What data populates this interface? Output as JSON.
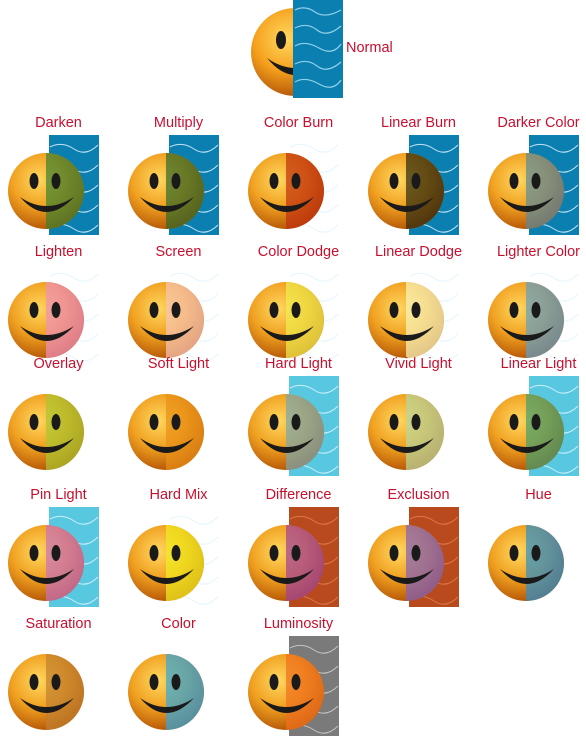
{
  "normal": {
    "label": "Normal"
  },
  "modes": [
    {
      "label": "Darken",
      "icon": "smiley-darken-blend",
      "face": "#f0a020",
      "overlay": "#0a7fb0",
      "tint": "#3a8030",
      "strip": "blue"
    },
    {
      "label": "Multiply",
      "icon": "smiley-multiply-blend",
      "face": "#f0a020",
      "overlay": "#0a7fb0",
      "tint": "#2f6a2a",
      "strip": "blue"
    },
    {
      "label": "Color Burn",
      "icon": "smiley-color-burn-blend",
      "face": "#f0a020",
      "overlay": "#ffffff",
      "tint": "#c03010",
      "strip": "white"
    },
    {
      "label": "Linear Burn",
      "icon": "smiley-linear-burn-blend",
      "face": "#f0a020",
      "overlay": "#0a7fb0",
      "tint": "#2a2a10",
      "strip": "blue"
    },
    {
      "label": "Darker Color",
      "icon": "smiley-darker-color-blend",
      "face": "#f0a020",
      "overlay": "#0a7fb0",
      "tint": "#5a8aa0",
      "strip": "blue"
    },
    {
      "label": "Lighten",
      "icon": "smiley-lighten-blend",
      "face": "#f0a020",
      "overlay": "#ffffff",
      "tint": "#f090c0",
      "strip": "white"
    },
    {
      "label": "Screen",
      "icon": "smiley-screen-blend",
      "face": "#f0a020",
      "overlay": "#ffffff",
      "tint": "#f8c8b8",
      "strip": "white"
    },
    {
      "label": "Color Dodge",
      "icon": "smiley-color-dodge-blend",
      "face": "#f0a020",
      "overlay": "#ffffff",
      "tint": "#f0f050",
      "strip": "white"
    },
    {
      "label": "Linear Dodge",
      "icon": "smiley-linear-dodge-blend",
      "face": "#f0a020",
      "overlay": "#ffffff",
      "tint": "#f8f8c0",
      "strip": "white"
    },
    {
      "label": "Lighter Color",
      "icon": "smiley-lighter-color-blend",
      "face": "#f0a020",
      "overlay": "#ffffff",
      "tint": "#60a0c8",
      "strip": "white"
    },
    {
      "label": "Overlay",
      "icon": "smiley-overlay-blend",
      "face": "#f0a020",
      "overlay": "#ffffff",
      "tint": "#a8c830",
      "strip": "none"
    },
    {
      "label": "Soft Light",
      "icon": "smiley-soft-light-blend",
      "face": "#f0a020",
      "overlay": "#ffffff",
      "tint": "#e89018",
      "strip": "none"
    },
    {
      "label": "Hard Light",
      "icon": "smiley-hard-light-blend",
      "face": "#f0a020",
      "overlay": "#58c8e0",
      "tint": "#78a8b0",
      "strip": "cyan"
    },
    {
      "label": "Vivid Light",
      "icon": "smiley-vivid-light-blend",
      "face": "#f0a020",
      "overlay": "#ffffff",
      "tint": "#b8d8a0",
      "strip": "none"
    },
    {
      "label": "Linear Light",
      "icon": "smiley-linear-light-blend",
      "face": "#f0a020",
      "overlay": "#58c8e0",
      "tint": "#40a070",
      "strip": "cyan"
    },
    {
      "label": "Pin Light",
      "icon": "smiley-pin-light-blend",
      "face": "#f0a020",
      "overlay": "#58c8e0",
      "tint": "#c870c0",
      "strip": "cyan"
    },
    {
      "label": "Hard Mix",
      "icon": "smiley-hard-mix-blend",
      "face": "#f0a020",
      "overlay": "#ffffff",
      "tint": "#f0f020",
      "strip": "white"
    },
    {
      "label": "Difference",
      "icon": "smiley-difference-blend",
      "face": "#f0a020",
      "overlay": "#c05020",
      "tint": "#a040a0",
      "strip": "rust"
    },
    {
      "label": "Exclusion",
      "icon": "smiley-exclusion-blend",
      "face": "#f0a020",
      "overlay": "#c05020",
      "tint": "#8060c0",
      "strip": "rust"
    },
    {
      "label": "Hue",
      "icon": "smiley-hue-blend",
      "face": "#f0a020",
      "overlay": "#2a90d0",
      "tint": "#2a90d0",
      "strip": "none"
    },
    {
      "label": "Saturation",
      "icon": "smiley-saturation-blend",
      "face": "#f0a020",
      "overlay": "#c08030",
      "tint": "#c08030",
      "strip": "none"
    },
    {
      "label": "Color",
      "icon": "smiley-color-blend",
      "face": "#f0a020",
      "overlay": "#30a8e0",
      "tint": "#30a8e0",
      "strip": "none"
    },
    {
      "label": "Luminosity",
      "icon": "smiley-luminosity-blend",
      "face": "#f0a020",
      "overlay": "#808080",
      "tint": "#f07020",
      "strip": "gray"
    }
  ],
  "colors": {
    "label": "#c8102e",
    "blue_water": "#0a7fb0",
    "cyan_water": "#58c8e0",
    "rust": "#b84a1e",
    "gray": "#7a7a7a"
  }
}
